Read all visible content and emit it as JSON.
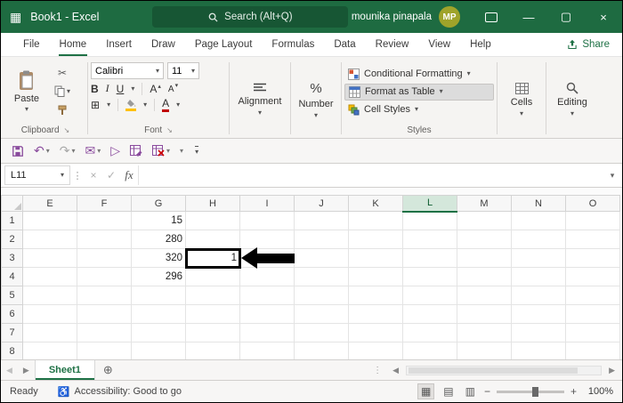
{
  "title_bar": {
    "app_title": "Book1 - Excel",
    "search_placeholder": "Search (Alt+Q)",
    "user_name": "mounika pinapala",
    "avatar_initials": "MP"
  },
  "menu": {
    "tabs": [
      "File",
      "Home",
      "Insert",
      "Draw",
      "Page Layout",
      "Formulas",
      "Data",
      "Review",
      "View",
      "Help"
    ],
    "active_tab": "Home",
    "share_label": "Share"
  },
  "ribbon": {
    "clipboard": {
      "label": "Clipboard",
      "paste": "Paste"
    },
    "font": {
      "label": "Font",
      "family": "Calibri",
      "size": "11",
      "bold": "B",
      "italic": "I",
      "underline": "U",
      "font_char": "A"
    },
    "alignment": {
      "label": "Alignment"
    },
    "number": {
      "label": "Number"
    },
    "styles": {
      "label": "Styles",
      "conditional": "Conditional Formatting",
      "format_table": "Format as Table",
      "cell_styles": "Cell Styles"
    },
    "cells": {
      "label": "Cells"
    },
    "editing": {
      "label": "Editing"
    }
  },
  "formula_bar": {
    "name_box": "L11",
    "fx_label": "fx",
    "value": ""
  },
  "grid": {
    "columns": [
      "E",
      "F",
      "G",
      "H",
      "I",
      "J",
      "K",
      "L",
      "M",
      "N",
      "O"
    ],
    "rows": [
      "1",
      "2",
      "3",
      "4",
      "5",
      "6",
      "7",
      "8"
    ],
    "selected_column": "L",
    "annotated_cell": "H3",
    "cells": {
      "G1": "15",
      "G2": "280",
      "G3": "320",
      "G4": "296",
      "H3": "1"
    }
  },
  "sheet_bar": {
    "tabs": [
      "Sheet1"
    ]
  },
  "status_bar": {
    "ready": "Ready",
    "accessibility": "Accessibility: Good to go",
    "zoom": "100%"
  },
  "colors": {
    "accent_green": "#1e7145",
    "titlebar_green": "#1e6b41",
    "annotation_black": "#000000"
  },
  "icons": {
    "app_grid": "▦",
    "minimize": "—",
    "maximize": "▢",
    "close": "×",
    "dropdown": "▾",
    "up_small": "▴",
    "dialog_launcher": "↘",
    "scissors": "✂",
    "undo": "↶",
    "redo": "↷",
    "mail": "✉",
    "flag": "▷",
    "dots": "⋮",
    "cancel": "×",
    "enter": "✓",
    "add_sheet": "⊕",
    "left_arrow": "◀",
    "right_arrow": "▶",
    "borders": "⊞",
    "percent": "%",
    "zoom_out": "−",
    "zoom_in": "+",
    "accessibility": "♿",
    "view_normal": "▦",
    "view_page_layout": "▤",
    "view_page_break": "▥"
  }
}
